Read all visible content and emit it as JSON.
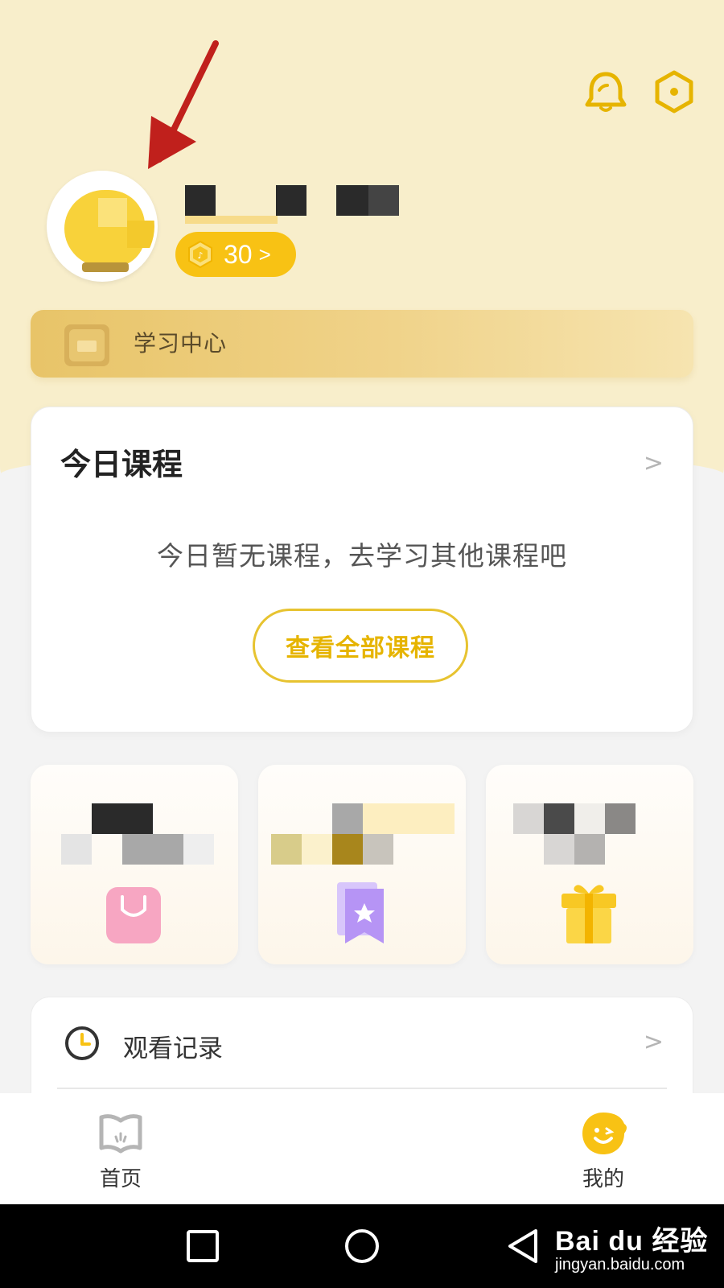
{
  "header": {
    "coins": "30",
    "coin_chevron": ">"
  },
  "study_center": {
    "label": "学习中心"
  },
  "today_course": {
    "title": "今日课程",
    "arrow": ">",
    "empty_text": "今日暂无课程，去学习其他课程吧",
    "button_label": "查看全部课程"
  },
  "features": [
    {
      "icon": "shopping-bag-icon",
      "color": "#f7a6c2"
    },
    {
      "icon": "bookmark-star-icon",
      "color": "#b694f5"
    },
    {
      "icon": "gift-icon",
      "color": "#f8c824"
    }
  ],
  "history": {
    "label": "观看记录",
    "arrow": ">"
  },
  "tabbar": {
    "home_label": "首页",
    "me_label": "我的"
  },
  "watermark": {
    "logo": "Bai du 经验",
    "url": "jingyan.baidu.com"
  },
  "colors": {
    "accent": "#f8c214",
    "header_bg": "#f8eecb",
    "study_bar": "#e8c468",
    "button_text": "#e6b400"
  }
}
